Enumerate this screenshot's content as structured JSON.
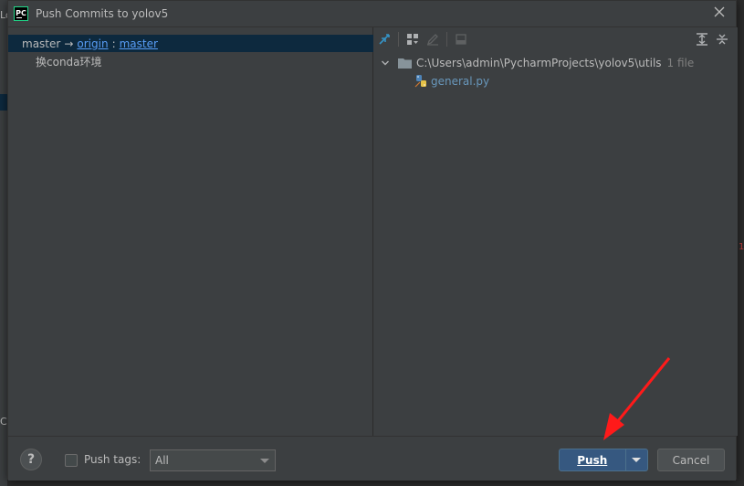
{
  "dialog": {
    "title": "Push Commits to yolov5",
    "app_icon_text": "PC"
  },
  "left": {
    "local_branch": "master",
    "arrow": "→",
    "remote": "origin",
    "separator": ":",
    "remote_branch": "master",
    "commits": [
      "换conda环境"
    ]
  },
  "right": {
    "folder_path": "C:\\Users\\admin\\PycharmProjects\\yolov5\\utils",
    "file_count": "1 file",
    "files": [
      "general.py"
    ]
  },
  "footer": {
    "help_label": "?",
    "push_tags_label": "Push tags:",
    "push_tags_value": "All",
    "push_label": "Push",
    "cancel_label": "Cancel"
  },
  "background": {
    "left_text": "Lo",
    "left_text2": "C",
    "right_number": "1"
  },
  "colors": {
    "accent_blue": "#365880",
    "link": "#589df6",
    "selection": "#0d293e",
    "annotation_arrow": "#ff1a1a"
  }
}
